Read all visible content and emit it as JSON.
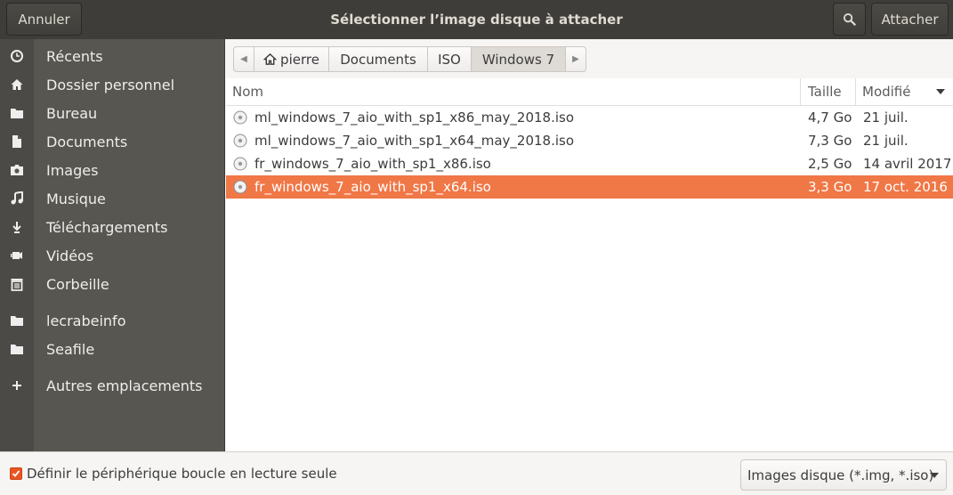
{
  "header": {
    "cancel_label": "Annuler",
    "title": "Sélectionner l’image disque à attacher",
    "attach_label": "Attacher",
    "search_icon": "search-icon"
  },
  "sidebar": {
    "items": [
      {
        "label": "Récents",
        "icon": "clock-icon"
      },
      {
        "label": "Dossier personnel",
        "icon": "home-icon"
      },
      {
        "label": "Bureau",
        "icon": "folder-icon"
      },
      {
        "label": "Documents",
        "icon": "document-icon"
      },
      {
        "label": "Images",
        "icon": "camera-icon"
      },
      {
        "label": "Musique",
        "icon": "music-icon"
      },
      {
        "label": "Téléchargements",
        "icon": "download-icon"
      },
      {
        "label": "Vidéos",
        "icon": "video-icon"
      },
      {
        "label": "Corbeille",
        "icon": "trash-icon"
      },
      {
        "label": "lecrabeinfo",
        "icon": "folder-icon"
      },
      {
        "label": "Seafile",
        "icon": "folder-icon"
      },
      {
        "label": "Autres emplacements",
        "icon": "plus-icon"
      }
    ]
  },
  "pathbar": {
    "crumbs": [
      "pierre",
      "Documents",
      "ISO",
      "Windows 7"
    ],
    "active_index": 3
  },
  "columns": {
    "name": "Nom",
    "size": "Taille",
    "modified": "Modifié"
  },
  "files": [
    {
      "name": "ml_windows_7_aio_with_sp1_x86_may_2018.iso",
      "size": "4,7 Go",
      "modified": "21 juil.",
      "selected": false
    },
    {
      "name": "ml_windows_7_aio_with_sp1_x64_may_2018.iso",
      "size": "7,3 Go",
      "modified": "21 juil.",
      "selected": false
    },
    {
      "name": "fr_windows_7_aio_with_sp1_x86.iso",
      "size": "2,5 Go",
      "modified": "14 avril 2017",
      "selected": false
    },
    {
      "name": "fr_windows_7_aio_with_sp1_x64.iso",
      "size": "3,3 Go",
      "modified": "17 oct. 2016",
      "selected": true
    }
  ],
  "bottom": {
    "readonly_checkbox_label": "Définir le périphérique boucle en lecture seule",
    "readonly_checked": true,
    "filter_label": "Images disque (*.img, *.iso)"
  },
  "colors": {
    "headerbar": "#3e3d39",
    "sidebar": "#575650",
    "selection": "#f07746",
    "checkbox": "#e95420"
  }
}
